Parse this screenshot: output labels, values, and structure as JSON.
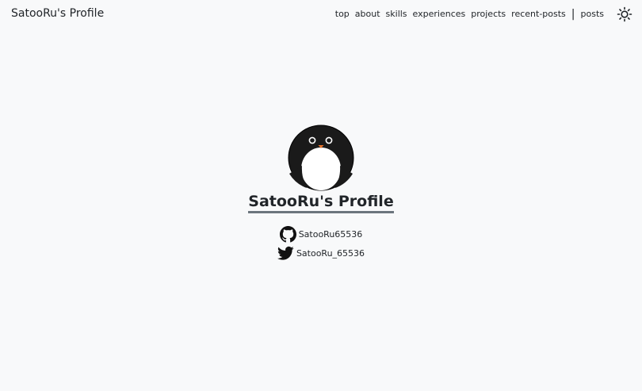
{
  "header": {
    "brand": "SatooRu's Profile",
    "nav": [
      "top",
      "about",
      "skills",
      "experiences",
      "projects",
      "recent-posts"
    ],
    "separator": "|",
    "posts": "posts",
    "theme_icon": "sun-icon"
  },
  "hero": {
    "avatar_icon": "penguin-avatar",
    "title": "SatooRu's Profile",
    "links": [
      {
        "icon": "github-icon",
        "label": "SatooRu65536"
      },
      {
        "icon": "twitter-icon",
        "label": "SatooRu_65536"
      }
    ]
  },
  "colors": {
    "background": "#f8f9fa",
    "text": "#212529",
    "underline": "#6c757d"
  }
}
